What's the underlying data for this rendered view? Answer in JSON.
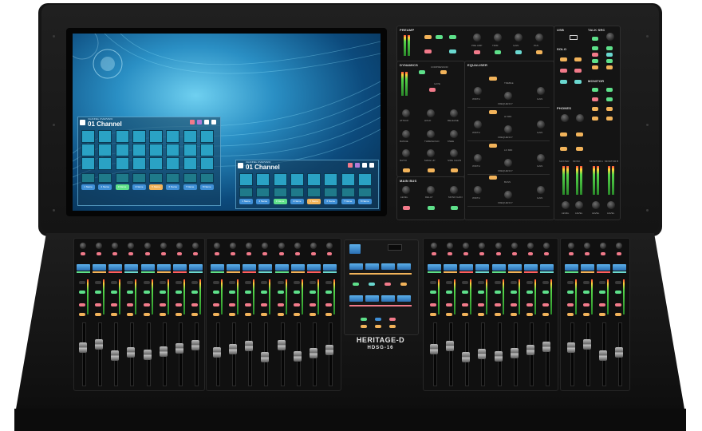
{
  "product": {
    "brand_line": "HERITAGE-D",
    "model_line": "HDSG-16"
  },
  "screen": {
    "windows": [
      {
        "title": "01 Channel",
        "subtitle": "CHANNEL OVERVIEW",
        "scene_labels": [
          "1 Name",
          "2 Name",
          "3 Name",
          "4 Name",
          "5 Name",
          "6 Name",
          "7 Name",
          "8 Name"
        ]
      },
      {
        "title": "01 Channel",
        "subtitle": "CHANNEL OVERVIEW",
        "scene_labels": [
          "1 Name",
          "2 Name",
          "3 Name",
          "4 Name",
          "5 Name",
          "6 Name",
          "7 Name",
          "8 Name"
        ]
      }
    ]
  },
  "control_panel": {
    "sections": {
      "preamp": "PREAMP",
      "dynamics": "DYNAMICS",
      "equaliser": "EQUALISER",
      "main_bus": "MAIN BUS",
      "usb": "USB",
      "talk_src": "TALK SRC",
      "solo": "SOLO",
      "monitor": "MONITOR",
      "phones": "PHONES"
    },
    "preamp_knobs": [
      "PRE AMP",
      "TRIM",
      "GAIN",
      "PAN"
    ],
    "dynamics_labels": [
      "COMPRESSOR",
      "GATE"
    ],
    "dynamics_knobs": [
      "ATTACK",
      "HOLD",
      "RELEASE",
      "RANGE",
      "THRESHOLD",
      "KNEE",
      "RATIO",
      "MAKE UP",
      "SIDE CHAIN"
    ],
    "eq_bands": [
      "TREBLE",
      "HI MID",
      "LO MID",
      "BASS"
    ],
    "eq_knobs": [
      "WIDTH",
      "FREQUENCY",
      "GAIN"
    ],
    "main_bus_knobs": [
      "LEVEL",
      "DELAY",
      "MONO GAIN"
    ],
    "meter_labels": [
      "MASTER",
      "MONO",
      "MONITOR A",
      "MONITOR B"
    ],
    "level_labels": [
      "LEVEL",
      "LEVEL",
      "LEVEL",
      "LEVEL"
    ]
  },
  "colors": {
    "lcd_blue": "#3f8fd6",
    "button_green": "#5ee08a",
    "button_orange": "#f2b35a",
    "button_pink": "#f27a8a",
    "button_purple": "#b07ad8",
    "button_teal": "#6ad8d0",
    "fader_cap": "#a8a8a8"
  }
}
